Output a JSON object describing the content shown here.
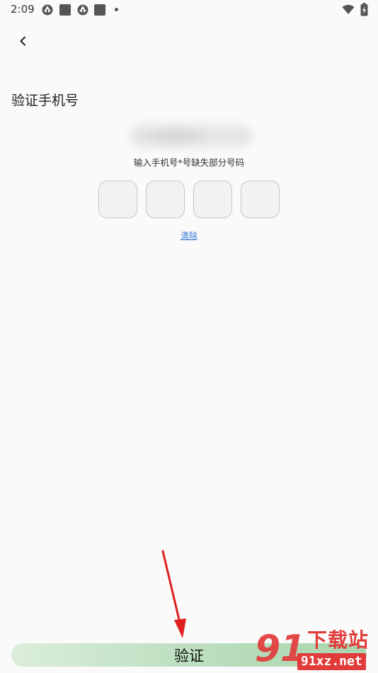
{
  "status_bar": {
    "time": "2:09",
    "icons": [
      "aperture-icon",
      "app-square-icon",
      "aperture-icon",
      "app-square-icon",
      "dot-icon"
    ],
    "right_icons": [
      "wifi-icon",
      "battery-charging-icon"
    ]
  },
  "nav": {
    "back_icon": "chevron-left-icon"
  },
  "page": {
    "title": "验证手机号",
    "hint": "输入手机号*号缺失部分号码",
    "code_digits": [
      "",
      "",
      "",
      ""
    ],
    "clear_label": "清除",
    "verify_label": "验证"
  },
  "watermark": {
    "logo_text": "91",
    "cn_text": "下载站",
    "url_text": "91xz.net"
  },
  "colors": {
    "accent_link": "#3a7bd5",
    "button_green": "#a9d6ad",
    "annotation_arrow": "#e02020",
    "watermark_red": "#e23b3b"
  }
}
